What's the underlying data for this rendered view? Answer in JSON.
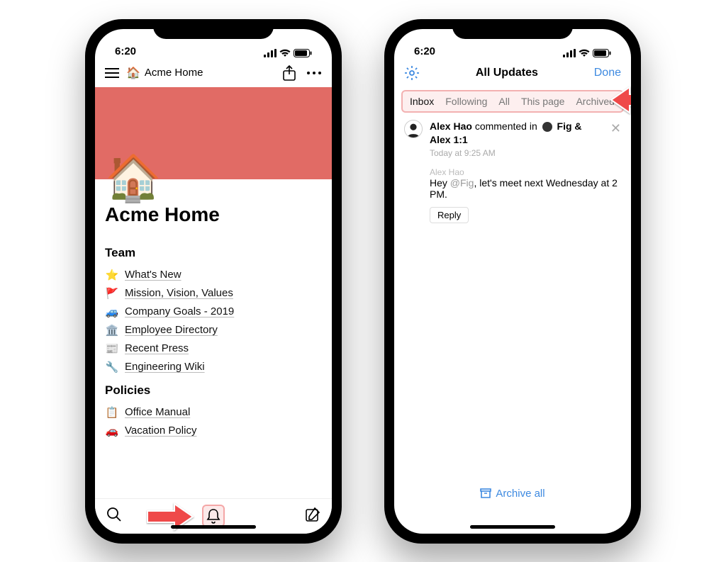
{
  "status": {
    "time": "6:20"
  },
  "phone1": {
    "breadcrumb_icon": "🏠",
    "breadcrumb": "Acme Home",
    "page_icon": "🏠",
    "page_title": "Acme Home",
    "sections": [
      {
        "title": "Team",
        "items": [
          {
            "emoji": "⭐",
            "label": "What's New"
          },
          {
            "emoji": "🚩",
            "label": "Mission, Vision, Values"
          },
          {
            "emoji": "🚙",
            "label": "Company Goals - 2019"
          },
          {
            "emoji": "🏛️",
            "label": "Employee Directory"
          },
          {
            "emoji": "📰",
            "label": "Recent Press"
          },
          {
            "emoji": "🔧",
            "label": "Engineering Wiki"
          }
        ]
      },
      {
        "title": "Policies",
        "items": [
          {
            "emoji": "📋",
            "label": "Office Manual"
          },
          {
            "emoji": "🚗",
            "label": "Vacation Policy"
          }
        ]
      }
    ]
  },
  "phone2": {
    "title": "All Updates",
    "done": "Done",
    "tabs": [
      "Inbox",
      "Following",
      "All",
      "This page",
      "Archived"
    ],
    "update": {
      "author": "Alex Hao",
      "action": "commented in",
      "page": "Fig & Alex 1:1",
      "timestamp": "Today at 9:25 AM"
    },
    "comment": {
      "author": "Alex Hao",
      "text_prefix": "Hey ",
      "mention": "@Fig",
      "text_suffix": ", let's meet next Wednesday at 2 PM."
    },
    "reply": "Reply",
    "archive_all": "Archive all"
  }
}
